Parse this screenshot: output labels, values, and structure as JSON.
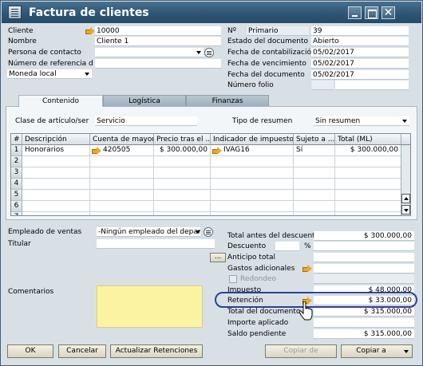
{
  "window": {
    "title": "Factura de clientes"
  },
  "header_left": {
    "cliente_label": "Cliente",
    "cliente_value": "10000",
    "nombre_label": "Nombre",
    "nombre_value": "Cliente 1",
    "contacto_label": "Persona de contacto",
    "contacto_value": "",
    "referencia_label": "Número de referencia d",
    "referencia_value": "",
    "moneda_value": "Moneda local"
  },
  "header_right": {
    "numero_label": "Nº",
    "serie_value": "Primario",
    "numero_value": "39",
    "estado_label": "Estado del documento",
    "estado_value": "Abierto",
    "contabilizacion_label": "Fecha de contabilización",
    "contabilizacion_value": "05/02/2017",
    "vencimiento_label": "Fecha de vencimiento",
    "vencimiento_value": "05/02/2017",
    "documento_label": "Fecha del documento",
    "documento_value": "05/02/2017",
    "folio_label": "Número folio",
    "folio_value": ""
  },
  "tabs": [
    {
      "label": "Contenido",
      "active": true
    },
    {
      "label": "Logística",
      "active": false
    },
    {
      "label": "Finanzas",
      "active": false
    }
  ],
  "content": {
    "clase_label": "Clase de artículo/ser",
    "clase_value": "Servicio",
    "resumen_label": "Tipo de resumen",
    "resumen_value": "Sin resumen"
  },
  "grid": {
    "headers": [
      "#",
      "Descripción",
      "Cuenta de mayor",
      "Precio tras el ...",
      "Indicador de impuestos",
      "Sujeto a ...",
      "Total (ML)"
    ],
    "rows": [
      {
        "num": "1",
        "descripcion": "Honorarios",
        "cuenta": "420505",
        "precio": "$ 300.000,00",
        "impuesto": "IVAG16",
        "sujeto": "Sí",
        "total": "$ 300.000,00"
      }
    ],
    "empty_row_numbers": [
      "2",
      "3",
      "4",
      "5",
      "6",
      "7"
    ]
  },
  "bottom_left": {
    "empleado_label": "Empleado de ventas",
    "empleado_value": "-Ningún empleado del departa",
    "titular_label": "Titular",
    "titular_value": "",
    "comentarios_label": "Comentarios",
    "comentarios_value": ""
  },
  "totals": {
    "antes_descuento_label": "Total antes del descuento",
    "antes_descuento_value": "$ 300.000,00",
    "descuento_label": "Descuento",
    "descuento_pct": "",
    "descuento_pct_symbol": "%",
    "descuento_value": "",
    "anticipo_button_label": "...",
    "anticipo_label": "Anticipo total",
    "anticipo_value": "",
    "gastos_label": "Gastos adicionales",
    "gastos_value": "",
    "redondeo_label": "Redondeo",
    "redondeo_value": "",
    "impuesto_label": "Impuesto",
    "impuesto_value": "$ 48.000,00",
    "retencion_label": "Retención",
    "retencion_value": "$ 33.000,00",
    "total_doc_label": "Total del documento",
    "total_doc_value": "$ 315.000,00",
    "importe_label": "Importe aplicado",
    "importe_value": "",
    "saldo_label": "Saldo pendiente",
    "saldo_value": "$ 315.000,00"
  },
  "buttons": {
    "ok": "OK",
    "cancel": "Cancelar",
    "actualizar": "Actualizar Retenciones",
    "copiar_de": "Copiar de",
    "copiar_a": "Copiar a"
  },
  "colors": {
    "titlebar": "#2e5775",
    "comments_bg": "#fbf3a1",
    "highlight": "#2c3f9c"
  }
}
